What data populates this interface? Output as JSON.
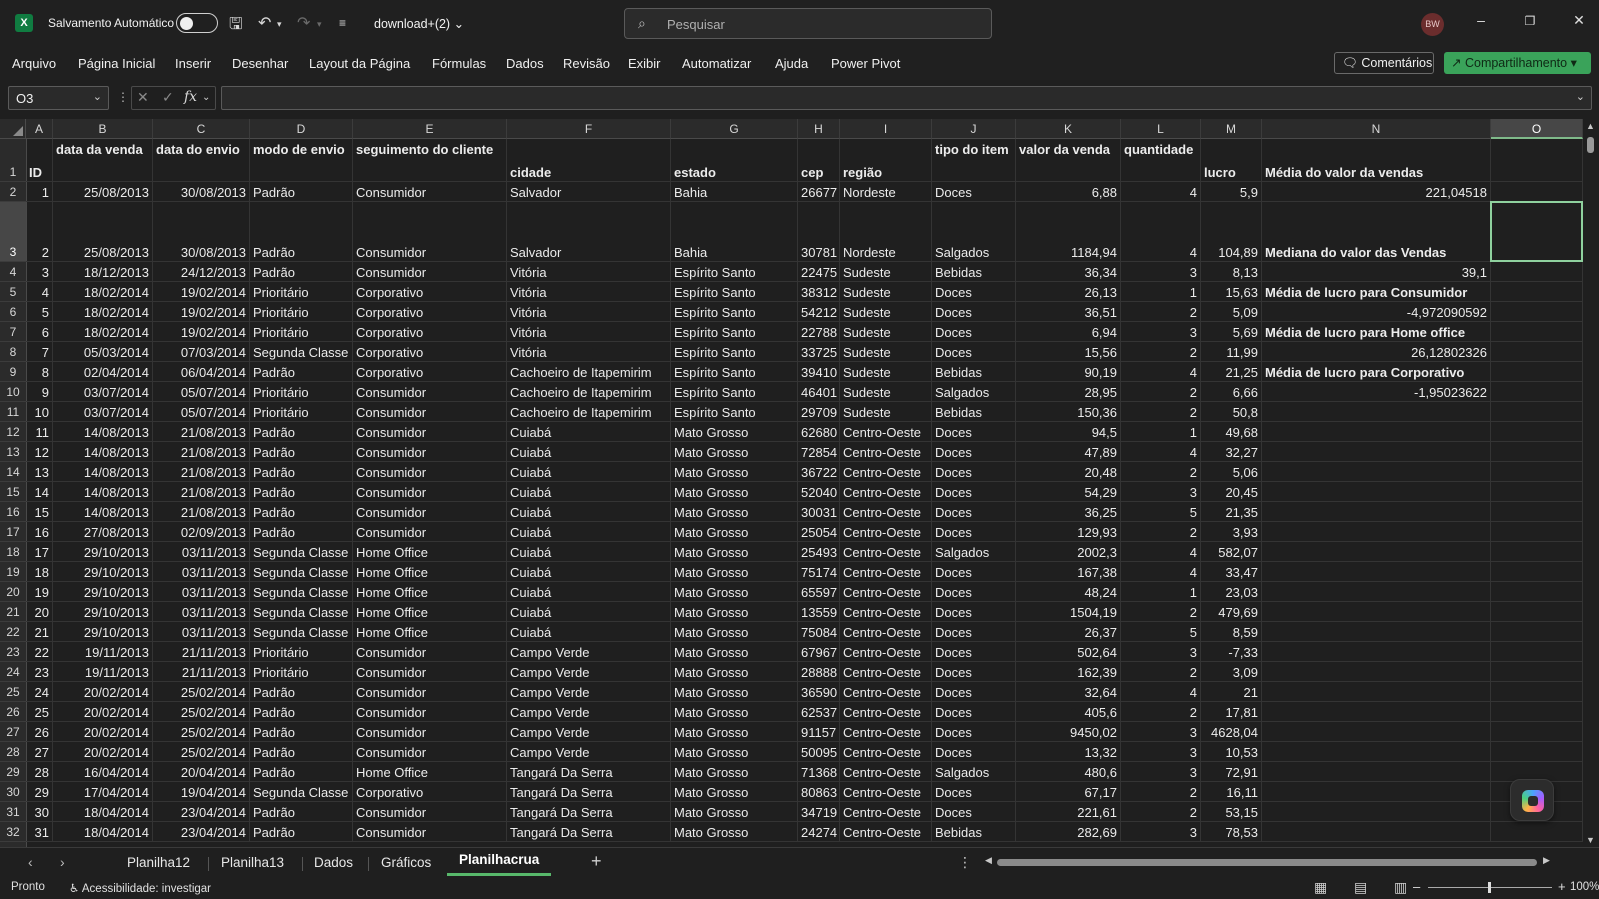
{
  "titlebar": {
    "app_icon": "excel-icon",
    "autosave_label": "Salvamento Automático",
    "autosave_state": "off",
    "file_name": "download+(2)",
    "search_placeholder": "Pesquisar",
    "avatar_initials": "BW"
  },
  "menu": [
    "Arquivo",
    "Página Inicial",
    "Inserir",
    "Desenhar",
    "Layout da Página",
    "Fórmulas",
    "Dados",
    "Revisão",
    "Exibir",
    "Automatizar",
    "Ajuda",
    "Power Pivot"
  ],
  "comments_label": "Comentários",
  "share_label": "Compartilhamento",
  "namebox": "O3",
  "formula_value": "",
  "columns": [
    "A",
    "B",
    "C",
    "D",
    "E",
    "F",
    "G",
    "H",
    "I",
    "J",
    "K",
    "L",
    "M",
    "N",
    "O"
  ],
  "selected_column": "O",
  "selected_row": "3",
  "headers": [
    "ID",
    "data da venda",
    "data do envio",
    "modo de envio",
    "seguimento do cliente",
    "cidade",
    "estado",
    "cep",
    "região",
    "tipo do item",
    "valor da venda",
    "quantidade",
    "lucro"
  ],
  "rows": [
    [
      "1",
      "25/08/2013",
      "30/08/2013",
      "Padrão",
      "Consumidor",
      "Salvador",
      "Bahia",
      "26677",
      "Nordeste",
      "Doces",
      "6,88",
      "4",
      "5,9"
    ],
    [
      "2",
      "25/08/2013",
      "30/08/2013",
      "Padrão",
      "Consumidor",
      "Salvador",
      "Bahia",
      "30781",
      "Nordeste",
      "Salgados",
      "1184,94",
      "4",
      "104,89"
    ],
    [
      "3",
      "18/12/2013",
      "24/12/2013",
      "Padrão",
      "Consumidor",
      "Vitória",
      "Espírito Santo",
      "22475",
      "Sudeste",
      "Bebidas",
      "36,34",
      "3",
      "8,13"
    ],
    [
      "4",
      "18/02/2014",
      "19/02/2014",
      "Prioritário",
      "Corporativo",
      "Vitória",
      "Espírito Santo",
      "38312",
      "Sudeste",
      "Doces",
      "26,13",
      "1",
      "15,63"
    ],
    [
      "5",
      "18/02/2014",
      "19/02/2014",
      "Prioritário",
      "Corporativo",
      "Vitória",
      "Espírito Santo",
      "54212",
      "Sudeste",
      "Doces",
      "36,51",
      "2",
      "5,09"
    ],
    [
      "6",
      "18/02/2014",
      "19/02/2014",
      "Prioritário",
      "Corporativo",
      "Vitória",
      "Espírito Santo",
      "22788",
      "Sudeste",
      "Doces",
      "6,94",
      "3",
      "5,69"
    ],
    [
      "7",
      "05/03/2014",
      "07/03/2014",
      "Segunda Classe",
      "Corporativo",
      "Vitória",
      "Espírito Santo",
      "33725",
      "Sudeste",
      "Doces",
      "15,56",
      "2",
      "11,99"
    ],
    [
      "8",
      "02/04/2014",
      "06/04/2014",
      "Padrão",
      "Corporativo",
      "Cachoeiro de Itapemirim",
      "Espírito Santo",
      "39410",
      "Sudeste",
      "Bebidas",
      "90,19",
      "4",
      "21,25"
    ],
    [
      "9",
      "03/07/2014",
      "05/07/2014",
      "Prioritário",
      "Consumidor",
      "Cachoeiro de Itapemirim",
      "Espírito Santo",
      "46401",
      "Sudeste",
      "Salgados",
      "28,95",
      "2",
      "6,66"
    ],
    [
      "10",
      "03/07/2014",
      "05/07/2014",
      "Prioritário",
      "Consumidor",
      "Cachoeiro de Itapemirim",
      "Espírito Santo",
      "29709",
      "Sudeste",
      "Bebidas",
      "150,36",
      "2",
      "50,8"
    ],
    [
      "11",
      "14/08/2013",
      "21/08/2013",
      "Padrão",
      "Consumidor",
      "Cuiabá",
      "Mato Grosso",
      "62680",
      "Centro-Oeste",
      "Doces",
      "94,5",
      "1",
      "49,68"
    ],
    [
      "12",
      "14/08/2013",
      "21/08/2013",
      "Padrão",
      "Consumidor",
      "Cuiabá",
      "Mato Grosso",
      "72854",
      "Centro-Oeste",
      "Doces",
      "47,89",
      "4",
      "32,27"
    ],
    [
      "13",
      "14/08/2013",
      "21/08/2013",
      "Padrão",
      "Consumidor",
      "Cuiabá",
      "Mato Grosso",
      "36722",
      "Centro-Oeste",
      "Doces",
      "20,48",
      "2",
      "5,06"
    ],
    [
      "14",
      "14/08/2013",
      "21/08/2013",
      "Padrão",
      "Consumidor",
      "Cuiabá",
      "Mato Grosso",
      "52040",
      "Centro-Oeste",
      "Doces",
      "54,29",
      "3",
      "20,45"
    ],
    [
      "15",
      "14/08/2013",
      "21/08/2013",
      "Padrão",
      "Consumidor",
      "Cuiabá",
      "Mato Grosso",
      "30031",
      "Centro-Oeste",
      "Doces",
      "36,25",
      "5",
      "21,35"
    ],
    [
      "16",
      "27/08/2013",
      "02/09/2013",
      "Padrão",
      "Consumidor",
      "Cuiabá",
      "Mato Grosso",
      "25054",
      "Centro-Oeste",
      "Doces",
      "129,93",
      "2",
      "3,93"
    ],
    [
      "17",
      "29/10/2013",
      "03/11/2013",
      "Segunda Classe",
      "Home Office",
      "Cuiabá",
      "Mato Grosso",
      "25493",
      "Centro-Oeste",
      "Salgados",
      "2002,3",
      "4",
      "582,07"
    ],
    [
      "18",
      "29/10/2013",
      "03/11/2013",
      "Segunda Classe",
      "Home Office",
      "Cuiabá",
      "Mato Grosso",
      "75174",
      "Centro-Oeste",
      "Doces",
      "167,38",
      "4",
      "33,47"
    ],
    [
      "19",
      "29/10/2013",
      "03/11/2013",
      "Segunda Classe",
      "Home Office",
      "Cuiabá",
      "Mato Grosso",
      "65597",
      "Centro-Oeste",
      "Doces",
      "48,24",
      "1",
      "23,03"
    ],
    [
      "20",
      "29/10/2013",
      "03/11/2013",
      "Segunda Classe",
      "Home Office",
      "Cuiabá",
      "Mato Grosso",
      "13559",
      "Centro-Oeste",
      "Doces",
      "1504,19",
      "2",
      "479,69"
    ],
    [
      "21",
      "29/10/2013",
      "03/11/2013",
      "Segunda Classe",
      "Home Office",
      "Cuiabá",
      "Mato Grosso",
      "75084",
      "Centro-Oeste",
      "Doces",
      "26,37",
      "5",
      "8,59"
    ],
    [
      "22",
      "19/11/2013",
      "21/11/2013",
      "Prioritário",
      "Consumidor",
      "Campo Verde",
      "Mato Grosso",
      "67967",
      "Centro-Oeste",
      "Doces",
      "502,64",
      "3",
      "-7,33"
    ],
    [
      "23",
      "19/11/2013",
      "21/11/2013",
      "Prioritário",
      "Consumidor",
      "Campo Verde",
      "Mato Grosso",
      "28888",
      "Centro-Oeste",
      "Doces",
      "162,39",
      "2",
      "3,09"
    ],
    [
      "24",
      "20/02/2014",
      "25/02/2014",
      "Padrão",
      "Consumidor",
      "Campo Verde",
      "Mato Grosso",
      "36590",
      "Centro-Oeste",
      "Doces",
      "32,64",
      "4",
      "21"
    ],
    [
      "25",
      "20/02/2014",
      "25/02/2014",
      "Padrão",
      "Consumidor",
      "Campo Verde",
      "Mato Grosso",
      "62537",
      "Centro-Oeste",
      "Doces",
      "405,6",
      "2",
      "17,81"
    ],
    [
      "26",
      "20/02/2014",
      "25/02/2014",
      "Padrão",
      "Consumidor",
      "Campo Verde",
      "Mato Grosso",
      "91157",
      "Centro-Oeste",
      "Doces",
      "9450,02",
      "3",
      "4628,04"
    ],
    [
      "27",
      "20/02/2014",
      "25/02/2014",
      "Padrão",
      "Consumidor",
      "Campo Verde",
      "Mato Grosso",
      "50095",
      "Centro-Oeste",
      "Doces",
      "13,32",
      "3",
      "10,53"
    ],
    [
      "28",
      "16/04/2014",
      "20/04/2014",
      "Padrão",
      "Home Office",
      "Tangará Da Serra",
      "Mato Grosso",
      "71368",
      "Centro-Oeste",
      "Salgados",
      "480,6",
      "3",
      "72,91"
    ],
    [
      "29",
      "17/04/2014",
      "19/04/2014",
      "Segunda Classe",
      "Corporativo",
      "Tangará Da Serra",
      "Mato Grosso",
      "80863",
      "Centro-Oeste",
      "Doces",
      "67,17",
      "2",
      "16,11"
    ],
    [
      "30",
      "18/04/2014",
      "23/04/2014",
      "Padrão",
      "Consumidor",
      "Tangará Da Serra",
      "Mato Grosso",
      "34719",
      "Centro-Oeste",
      "Doces",
      "221,61",
      "2",
      "53,15"
    ],
    [
      "31",
      "18/04/2014",
      "23/04/2014",
      "Padrão",
      "Consumidor",
      "Tangará Da Serra",
      "Mato Grosso",
      "24274",
      "Centro-Oeste",
      "Bebidas",
      "282,69",
      "3",
      "78,53"
    ]
  ],
  "summary": {
    "media_vendas_label": "Média do  valor  da vendas",
    "media_vendas_value": "221,04518",
    "mediana_label": "Mediana do  valor  das  Vendas",
    "mediana_value": "39,1",
    "lucro_consumidor_label": "Média  de  lucro para Consumidor",
    "lucro_consumidor_value": "-4,972090592",
    "lucro_home_label": "Média  de  lucro para Home office",
    "lucro_home_value": "26,12802326",
    "lucro_corp_label": "Média de  lucro  para  Corporativo",
    "lucro_corp_value": "-1,95023622"
  },
  "sheets": [
    "Planilha12",
    "Planilha13",
    "Dados",
    "Gráficos",
    "Planilhacrua"
  ],
  "active_sheet": "Planilhacrua",
  "status": {
    "ready": "Pronto",
    "accessibility": "Acessibilidade: investigar",
    "zoom": "100%"
  }
}
